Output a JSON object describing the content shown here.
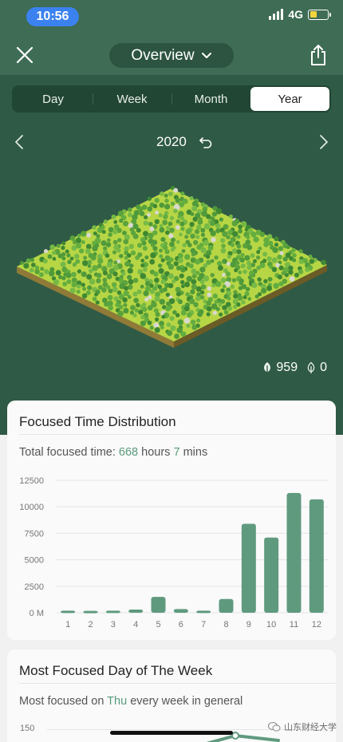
{
  "status": {
    "time": "10:56",
    "network": "4G"
  },
  "header": {
    "title": "Overview"
  },
  "tabs": [
    {
      "label": "Day",
      "active": false
    },
    {
      "label": "Week",
      "active": false
    },
    {
      "label": "Month",
      "active": false
    },
    {
      "label": "Year",
      "active": true
    }
  ],
  "year_nav": {
    "year": "2020"
  },
  "counts": {
    "healthy": "959",
    "withered": "0"
  },
  "focused_time": {
    "title": "Focused Time Distribution",
    "prefix": "Total focused time: ",
    "hours": "668",
    "hours_word": " hours ",
    "mins": "7",
    "mins_word": " mins"
  },
  "most_focused": {
    "title": "Most Focused Day of The Week",
    "prefix": "Most focused on ",
    "day": "Thu",
    "suffix": " every week in general",
    "first_tick": "150"
  },
  "watermark": "山东财经大学",
  "colors": {
    "accent": "#5a9a7c",
    "bar": "#5f9a7f",
    "dark_green": "#2f5a46"
  },
  "chart_data": {
    "type": "bar",
    "categories": [
      "1",
      "2",
      "3",
      "4",
      "5",
      "6",
      "7",
      "8",
      "9",
      "10",
      "11",
      "12"
    ],
    "values": [
      200,
      180,
      200,
      300,
      1500,
      350,
      200,
      1300,
      8400,
      7100,
      11300,
      10700
    ],
    "y_ticks": [
      "0 M",
      "2500",
      "5000",
      "7500",
      "10000",
      "12500"
    ],
    "ylim": [
      0,
      12500
    ],
    "grid": true
  }
}
